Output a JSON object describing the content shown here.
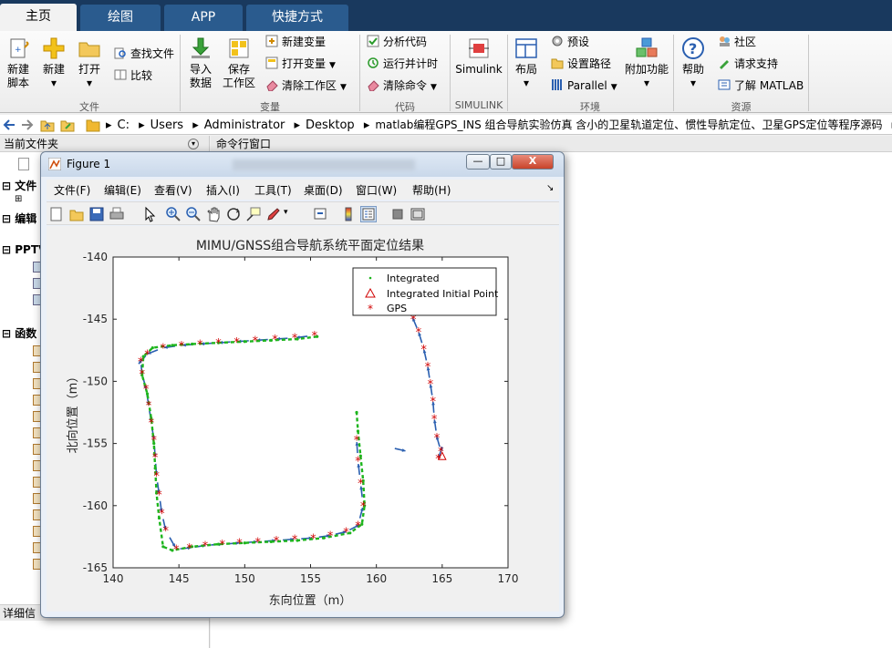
{
  "tabs": [
    {
      "label": "主页",
      "active": true
    },
    {
      "label": "绘图",
      "active": false
    },
    {
      "label": "APP",
      "active": false
    },
    {
      "label": "快捷方式",
      "active": false
    }
  ],
  "ribbon": {
    "file": {
      "new_script": [
        "新建",
        "脚本"
      ],
      "new": "新建",
      "open": "打开",
      "find_files": "查找文件",
      "compare": "比较",
      "group": "文件"
    },
    "variable": {
      "import": [
        "导入",
        "数据"
      ],
      "save": [
        "保存",
        "工作区"
      ],
      "new_var": "新建变量",
      "open_var": "打开变量",
      "clear_ws": "清除工作区",
      "group": "变量"
    },
    "code": {
      "analyze": "分析代码",
      "run_time": "运行并计时",
      "clear_cmd": "清除命令",
      "group": "代码"
    },
    "simulink": {
      "simulink": "Simulink",
      "group": "SIMULINK"
    },
    "env": {
      "layout": "布局",
      "prefs": "预设",
      "set_path": "设置路径",
      "parallel": "Parallel",
      "addons": "附加功能",
      "group": "环境"
    },
    "resources": {
      "help": "帮助",
      "community": "社区",
      "support": "请求支持",
      "learn": "了解 MATLAB",
      "group": "资源"
    }
  },
  "address": {
    "crumbs": [
      "C:",
      "Users",
      "Administrator",
      "Desktop",
      "matlab编程GPS_INS 组合导航实验仿真 含小的卫星轨道定位、惯性导航定位、卫星GPS定位等程序源码",
      "cc"
    ]
  },
  "left_pane": {
    "title": "当前文件夹",
    "sections": [
      "文件",
      "编辑",
      "PPTV",
      "函数"
    ],
    "footer": "详细信"
  },
  "command_window": {
    "title": "命令行窗口"
  },
  "figure": {
    "title": "Figure 1",
    "menu": [
      "文件(F)",
      "编辑(E)",
      "查看(V)",
      "插入(I)",
      "工具(T)",
      "桌面(D)",
      "窗口(W)",
      "帮助(H)"
    ],
    "win_minimize": "—",
    "win_maximize": "□",
    "win_close": "X"
  },
  "colors": {
    "integrated": "#1db51d",
    "gps": "#d00000",
    "arrow": "#2a5fb0",
    "tab_bar": "#19395e"
  },
  "chart_data": {
    "type": "scatter",
    "title": "MIMU/GNSS组合导航系统平面定位结果",
    "xlabel": "东向位置（m）",
    "ylabel": "北向位置（m）",
    "xlim": [
      140,
      170
    ],
    "ylim": [
      -165,
      -140
    ],
    "xticks": [
      140,
      145,
      150,
      155,
      160,
      165,
      170
    ],
    "yticks": [
      -140,
      -145,
      -150,
      -155,
      -160,
      -165
    ],
    "legend_position": "top-right",
    "legend": [
      "Integrated",
      "Integrated Initial Point",
      "GPS"
    ],
    "series": [
      {
        "name": "Integrated",
        "marker": "dot",
        "color": "#1db51d",
        "x": [
          155.5,
          154,
          152,
          150,
          148,
          146,
          144.5,
          143,
          142.3,
          142.2,
          142.6,
          142.9,
          143.1,
          143.2,
          143.3,
          143.5,
          143.8,
          144.5,
          146,
          148,
          150,
          152,
          154,
          156,
          158,
          158.9,
          159.1,
          159.0,
          158.8,
          158.6,
          158.5
        ],
        "y": [
          -146.4,
          -146.6,
          -146.7,
          -146.8,
          -146.9,
          -147.0,
          -147.1,
          -147.3,
          -148.0,
          -149.5,
          -151,
          -153,
          -155,
          -157,
          -159,
          -161,
          -163.3,
          -163.6,
          -163.3,
          -163.1,
          -163.0,
          -162.9,
          -162.8,
          -162.6,
          -162.2,
          -161.5,
          -160,
          -158,
          -156,
          -154,
          -152.5
        ]
      },
      {
        "name": "Integrated Initial Point",
        "marker": "triangle",
        "color": "#d00000",
        "x": [
          165.0
        ],
        "y": [
          -156.0
        ]
      },
      {
        "name": "GPS",
        "marker": "star",
        "color": "#d00000",
        "x": [
          155.3,
          153.8,
          152.3,
          150.8,
          149.4,
          148,
          146.6,
          145.2,
          143.8,
          142.6,
          142.1,
          142.2,
          142.5,
          142.7,
          142.9,
          143.1,
          143.2,
          143.3,
          143.5,
          143.7,
          144.0,
          144.8,
          145.8,
          147,
          148.3,
          149.6,
          151,
          152.4,
          153.8,
          155.2,
          156.5,
          157.7,
          158.6,
          159.0,
          158.8,
          158.6,
          158.5,
          164.7,
          164.9,
          164.6,
          164.4,
          164.3,
          164.1,
          163.9,
          163.6,
          163.2,
          162.8
        ],
        "y": [
          -146.3,
          -146.5,
          -146.6,
          -146.7,
          -146.8,
          -146.9,
          -147.0,
          -147.1,
          -147.3,
          -147.8,
          -148.4,
          -149.4,
          -150.6,
          -151.9,
          -153.3,
          -154.7,
          -156.1,
          -157.6,
          -159.1,
          -160.6,
          -162.0,
          -163.5,
          -163.4,
          -163.2,
          -163.1,
          -163.0,
          -162.9,
          -162.8,
          -162.7,
          -162.6,
          -162.4,
          -162.1,
          -161.6,
          -160,
          -158.2,
          -156.4,
          -154.7,
          -156.2,
          -155.6,
          -154.5,
          -153.0,
          -151.6,
          -150.2,
          -148.8,
          -147.4,
          -146.0,
          -145.0
        ]
      }
    ]
  }
}
